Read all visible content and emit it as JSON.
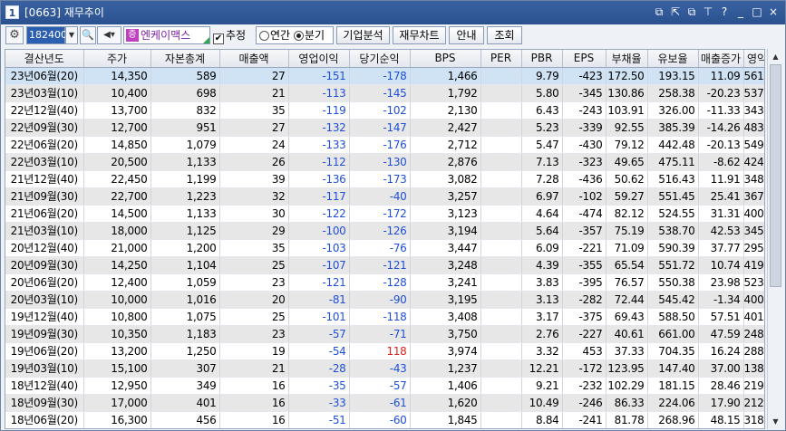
{
  "window": {
    "number": "1",
    "title": "[0663] 재무추이",
    "controls": [
      "⧉",
      "⇱",
      "⧉",
      "⊤",
      "?",
      "_",
      "□",
      "×"
    ]
  },
  "toolbar": {
    "stock_code": "182400",
    "company_badge": "증",
    "company_name": "엔케이맥스",
    "estimate_label": "추정",
    "estimate_checked": "✔",
    "radio_annual": "연간",
    "radio_quarter": "분기",
    "btn_company_analysis": "기업분석",
    "btn_financial_chart": "재무차트",
    "btn_guide": "안내",
    "btn_query": "조회"
  },
  "table": {
    "headers": [
      "결산년도",
      "주가",
      "자본총계",
      "매출액",
      "영업이익",
      "당기순익",
      "BPS",
      "PER",
      "PBR",
      "EPS",
      "부채율",
      "유보율",
      "매출증가",
      "영익률"
    ],
    "rows": [
      [
        "23년06월(20)",
        "14,350",
        "589",
        "27",
        "-151",
        "-178",
        "1,466",
        "",
        "9.79",
        "-423",
        "172.50",
        "193.15",
        "11.09",
        "561.05"
      ],
      [
        "23년03월(10)",
        "10,400",
        "698",
        "21",
        "-113",
        "-145",
        "1,792",
        "",
        "5.80",
        "-345",
        "130.86",
        "258.38",
        "-20.23",
        "537.86"
      ],
      [
        "22년12월(40)",
        "13,700",
        "832",
        "35",
        "-119",
        "-102",
        "2,130",
        "",
        "6.43",
        "-243",
        "103.91",
        "326.00",
        "-11.33",
        "343.39"
      ],
      [
        "22년09월(30)",
        "12,700",
        "951",
        "27",
        "-132",
        "-147",
        "2,427",
        "",
        "5.23",
        "-339",
        "92.55",
        "385.39",
        "-14.26",
        "483.25"
      ],
      [
        "22년06월(20)",
        "14,850",
        "1,079",
        "24",
        "-133",
        "-176",
        "2,712",
        "",
        "5.47",
        "-430",
        "79.12",
        "442.48",
        "-20.13",
        "549.55"
      ],
      [
        "22년03월(10)",
        "20,500",
        "1,133",
        "26",
        "-112",
        "-130",
        "2,876",
        "",
        "7.13",
        "-323",
        "49.65",
        "475.11",
        "-8.62",
        "424.78"
      ],
      [
        "21년12월(40)",
        "22,450",
        "1,199",
        "39",
        "-136",
        "-173",
        "3,082",
        "",
        "7.28",
        "-436",
        "50.62",
        "516.43",
        "11.91",
        "348.26"
      ],
      [
        "21년09월(30)",
        "22,700",
        "1,223",
        "32",
        "-117",
        "-40",
        "3,257",
        "",
        "6.97",
        "-102",
        "59.27",
        "551.45",
        "25.41",
        "367.00"
      ],
      [
        "21년06월(20)",
        "14,500",
        "1,133",
        "30",
        "-122",
        "-172",
        "3,123",
        "",
        "4.64",
        "-474",
        "82.12",
        "524.55",
        "31.31",
        "400.43"
      ],
      [
        "21년03월(10)",
        "18,000",
        "1,125",
        "29",
        "-100",
        "-126",
        "3,194",
        "",
        "5.64",
        "-357",
        "75.19",
        "538.70",
        "42.53",
        "345.25"
      ],
      [
        "20년12월(40)",
        "21,000",
        "1,200",
        "35",
        "-103",
        "-76",
        "3,447",
        "",
        "6.09",
        "-221",
        "71.09",
        "590.39",
        "37.77",
        "295.26"
      ],
      [
        "20년09월(30)",
        "14,250",
        "1,104",
        "25",
        "-107",
        "-121",
        "3,248",
        "",
        "4.39",
        "-355",
        "65.54",
        "551.72",
        "10.74",
        "419.74"
      ],
      [
        "20년06월(20)",
        "12,400",
        "1,059",
        "23",
        "-121",
        "-128",
        "3,241",
        "",
        "3.83",
        "-395",
        "76.57",
        "550.38",
        "23.98",
        "523.21"
      ],
      [
        "20년03월(10)",
        "10,000",
        "1,016",
        "20",
        "-81",
        "-90",
        "3,195",
        "",
        "3.13",
        "-282",
        "72.44",
        "545.42",
        "-1.34",
        "400.41"
      ],
      [
        "19년12월(40)",
        "10,800",
        "1,075",
        "25",
        "-101",
        "-118",
        "3,408",
        "",
        "3.17",
        "-375",
        "69.43",
        "588.50",
        "57.51",
        "401.09"
      ],
      [
        "19년09월(30)",
        "10,350",
        "1,183",
        "23",
        "-57",
        "-71",
        "3,750",
        "",
        "2.76",
        "-227",
        "40.61",
        "661.00",
        "47.59",
        "248.52"
      ],
      [
        "19년06월(20)",
        "13,200",
        "1,250",
        "19",
        "-54",
        "118",
        "3,974",
        "",
        "3.32",
        "453",
        "37.33",
        "704.35",
        "16.24",
        "288.74"
      ],
      [
        "19년03월(10)",
        "15,100",
        "307",
        "21",
        "-28",
        "-43",
        "1,237",
        "",
        "12.21",
        "-172",
        "123.95",
        "147.40",
        "37.00",
        "138.17"
      ],
      [
        "18년12월(40)",
        "12,950",
        "349",
        "16",
        "-35",
        "-57",
        "1,406",
        "",
        "9.21",
        "-232",
        "102.29",
        "181.15",
        "28.46",
        "219.03"
      ],
      [
        "18년09월(30)",
        "17,000",
        "401",
        "16",
        "-33",
        "-61",
        "1,620",
        "",
        "10.49",
        "-246",
        "86.33",
        "224.06",
        "17.90",
        "212.37"
      ],
      [
        "18년06월(20)",
        "16,300",
        "456",
        "16",
        "-51",
        "-60",
        "1,845",
        "",
        "8.84",
        "-241",
        "81.78",
        "268.96",
        "48.15",
        "318.87"
      ]
    ]
  }
}
